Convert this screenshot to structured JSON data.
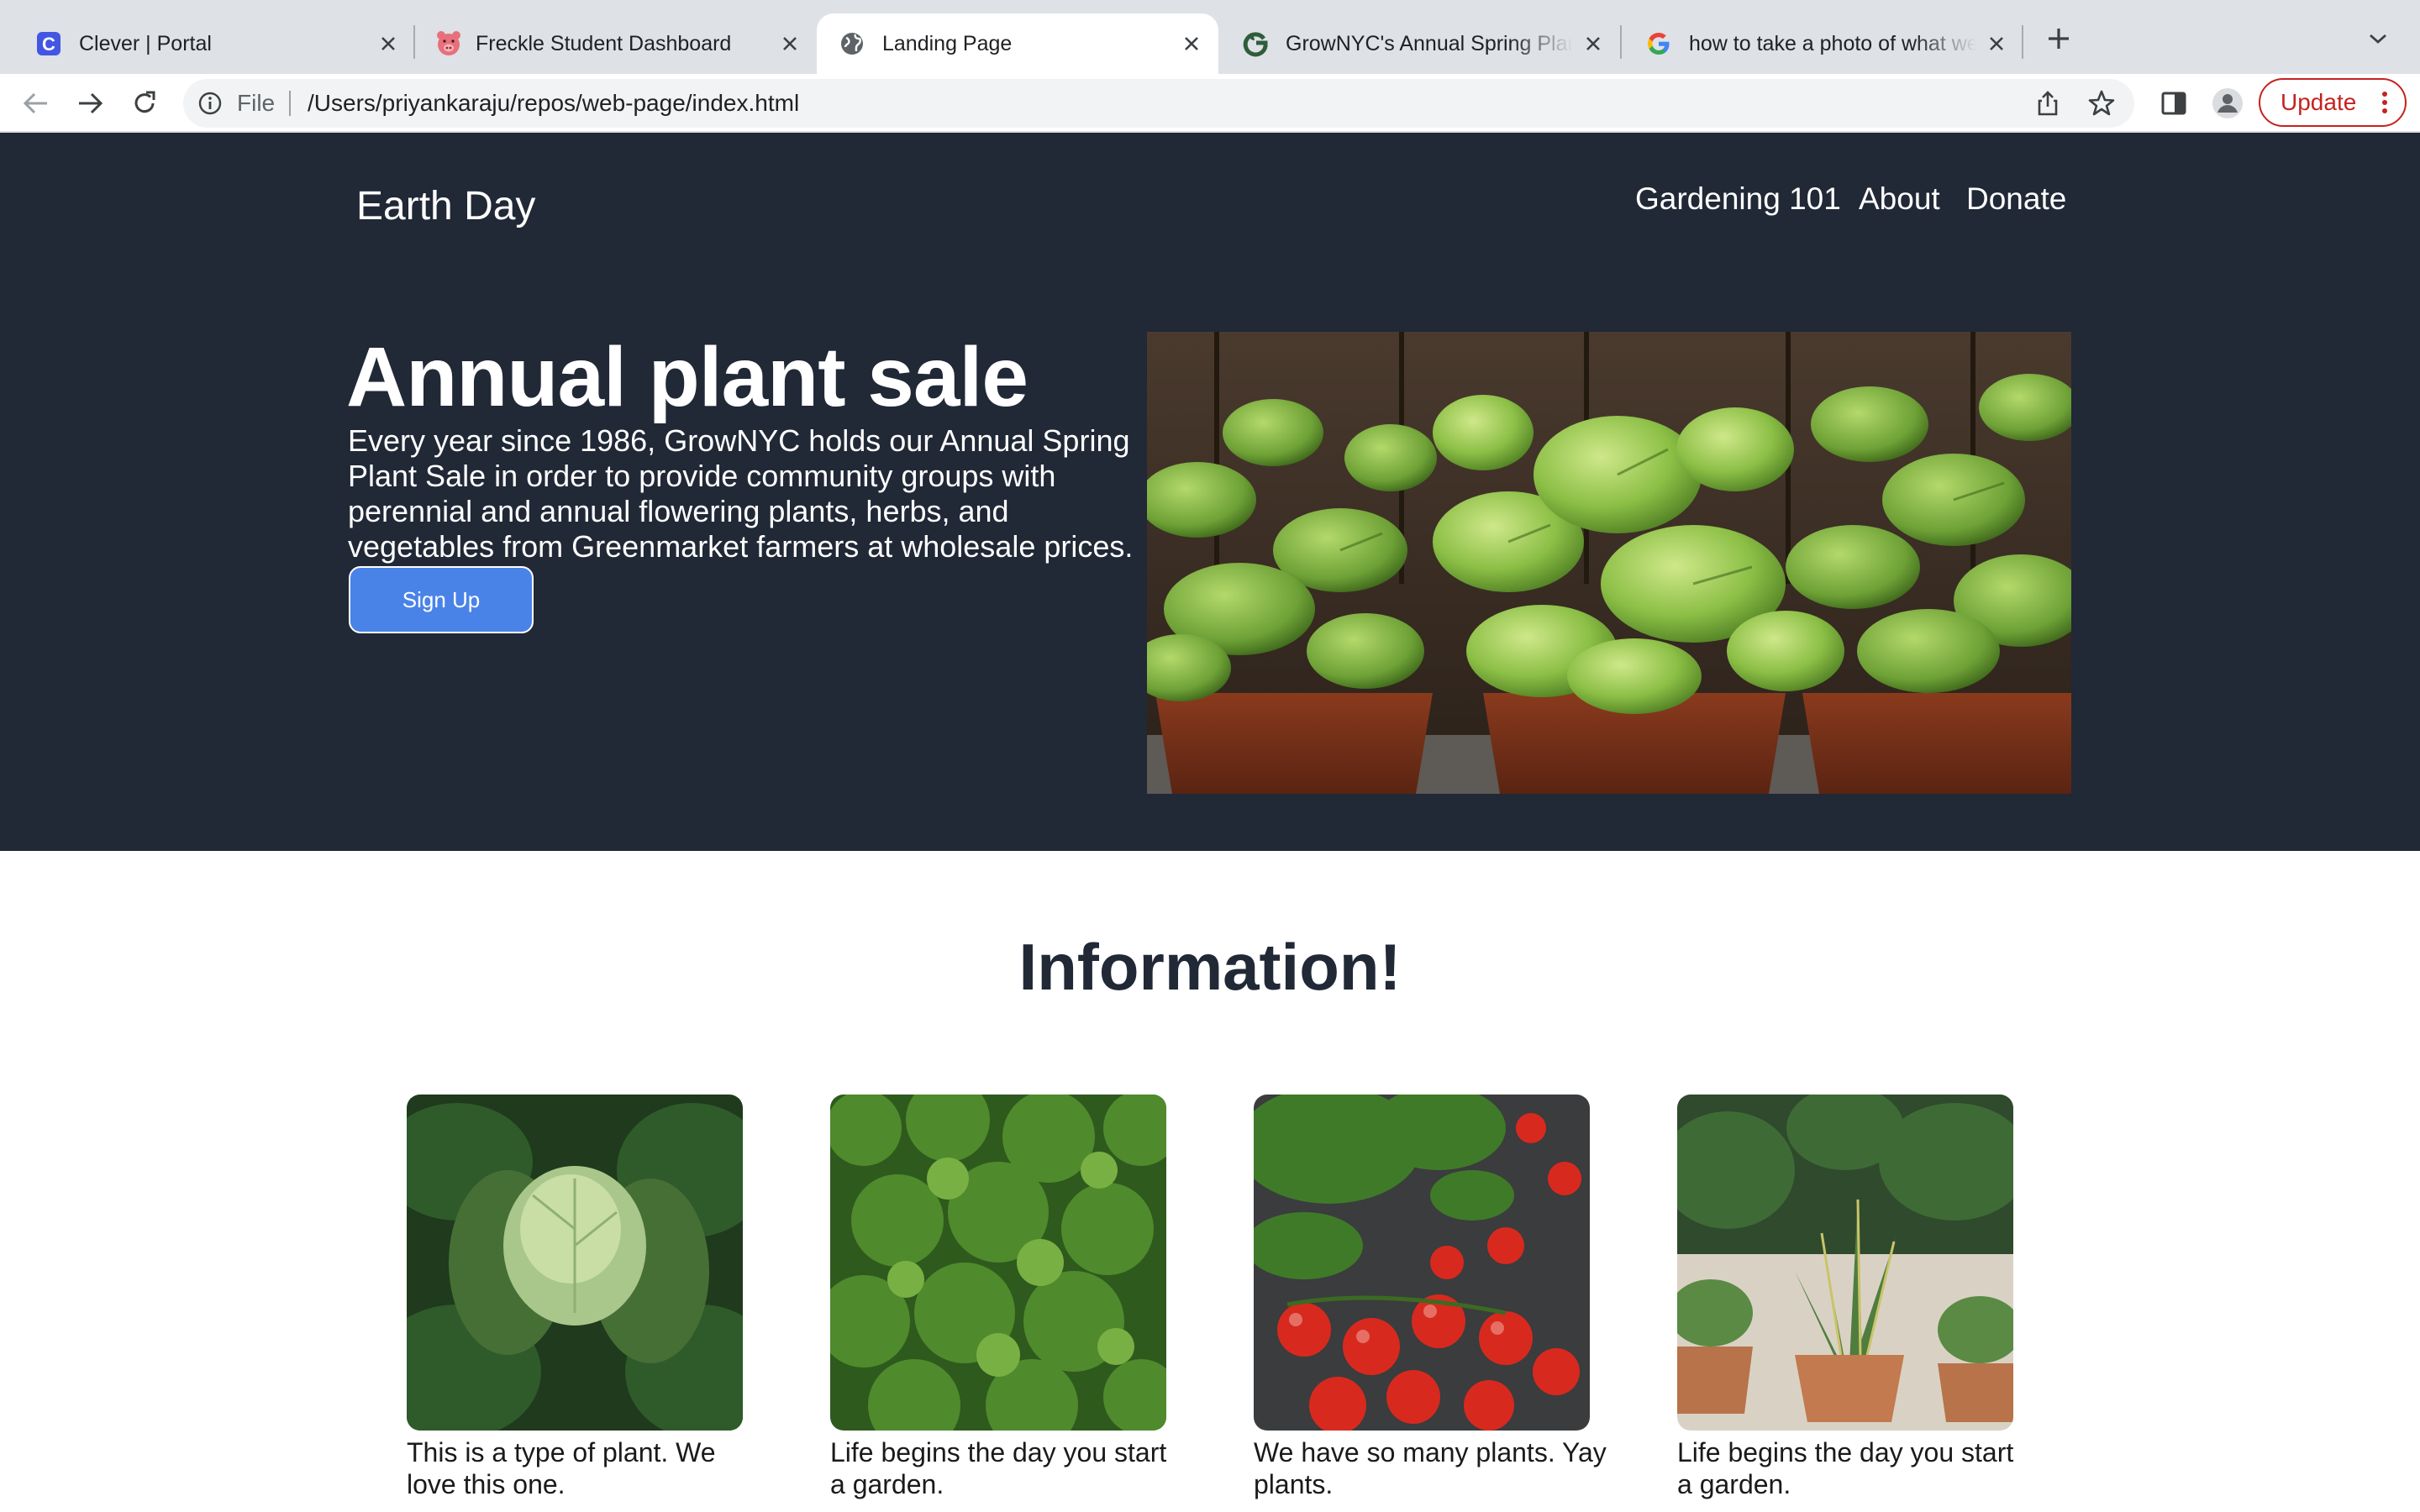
{
  "browser": {
    "tabs": [
      {
        "title": "Clever | Portal",
        "favicon": "clever-c-icon"
      },
      {
        "title": "Freckle Student Dashboard",
        "favicon": "freckle-pig-icon"
      },
      {
        "title": "Landing Page",
        "favicon": "globe-icon",
        "active": true
      },
      {
        "title": "GrowNYC's Annual Spring Plant Sale",
        "favicon": "grownyc-icon"
      },
      {
        "title": "how to take a photo of what we",
        "favicon": "google-g-icon"
      }
    ],
    "address": {
      "scheme_label": "File",
      "url": "/Users/priyankaraju/repos/web-page/index.html"
    },
    "update_label": "Update",
    "colors": {
      "update": "#c5221f",
      "tabstrip": "#dee1e6"
    }
  },
  "page": {
    "brand": "Earth Day",
    "nav": [
      "Gardening 101",
      "About",
      "Donate"
    ],
    "hero": {
      "title": "Annual plant sale",
      "text": "Every year since 1986, GrowNYC holds our Annual Spring Plant Sale in order to provide community groups with perennial and annual flowering plants, herbs, and vegetables from Greenmarket farmers at wholesale prices.",
      "button": "Sign Up",
      "image": "potted-herbs-basil-photo"
    },
    "info": {
      "title": "Information!",
      "cards": [
        {
          "image": "cabbage-photo",
          "caption": "This is a type of plant. We love this one."
        },
        {
          "image": "parsley-photo",
          "caption": "Life begins the day you start a garden."
        },
        {
          "image": "tomatoes-basil-photo",
          "caption": "We have so many plants. Yay plants."
        },
        {
          "image": "potted-houseplants-photo",
          "caption": "Life begins the day you start a garden."
        }
      ]
    },
    "colors": {
      "hero_bg": "#212836",
      "button": "#4a83e8",
      "heading": "#212836"
    }
  }
}
